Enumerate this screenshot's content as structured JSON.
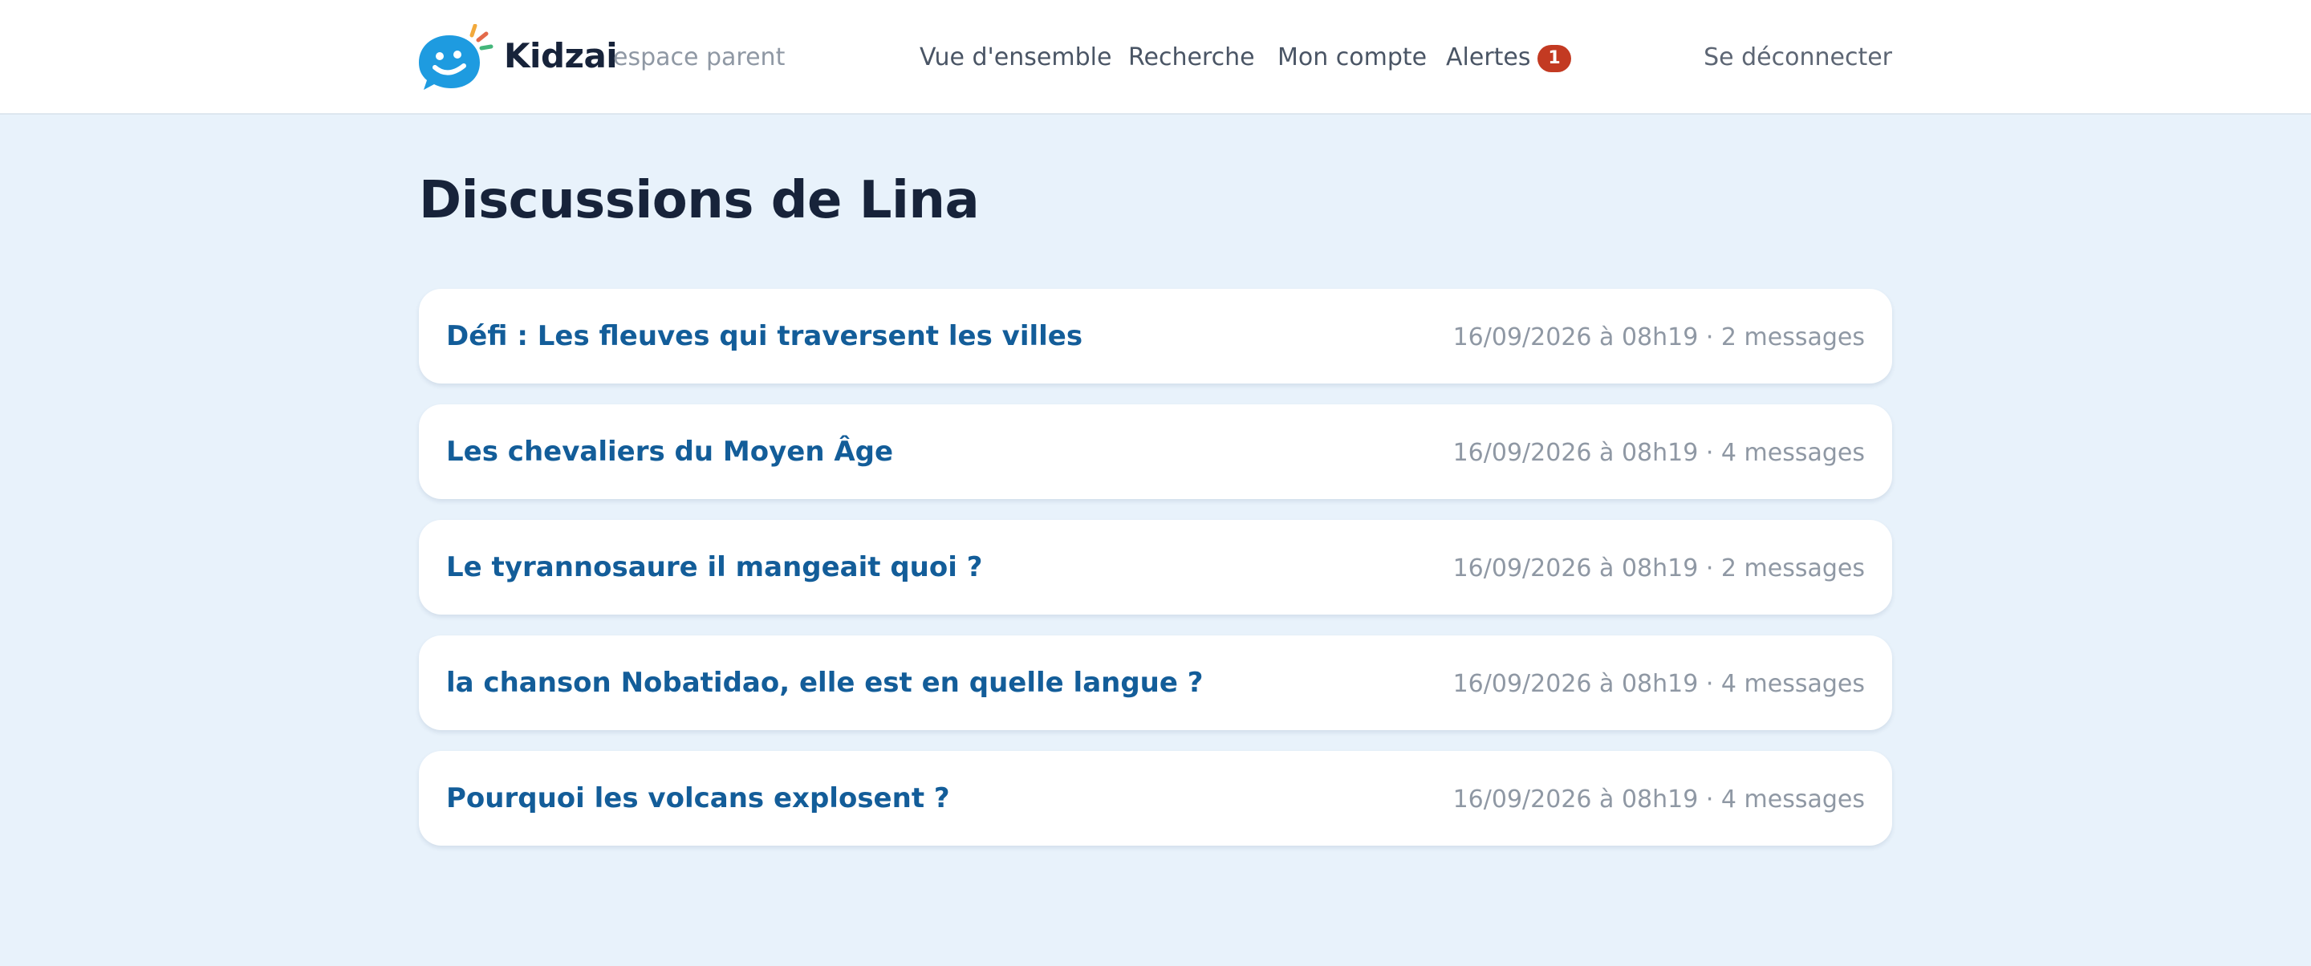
{
  "header": {
    "brand": "Kidzai",
    "brand_sub": "espace parent",
    "nav": {
      "overview": "Vue d'ensemble",
      "search": "Recherche",
      "account": "Mon compte",
      "alerts": "Alertes",
      "alerts_count": "1"
    },
    "logout": "Se déconnecter"
  },
  "colors": {
    "background": "#e8f2fb",
    "title": "#17233a",
    "link": "#135d99",
    "badge": "#c33a22",
    "logo_blue": "#1e9be0"
  },
  "page": {
    "title": "Discussions de Lina"
  },
  "discussions": [
    {
      "title": "Défi : Les fleuves qui traversent les villes",
      "meta": "16/09/2026 à 08h19 · 2 messages"
    },
    {
      "title": "Les chevaliers du Moyen Âge",
      "meta": "16/09/2026 à 08h19 · 4 messages"
    },
    {
      "title": "Le tyrannosaure il mangeait quoi ?",
      "meta": "16/09/2026 à 08h19 · 2 messages"
    },
    {
      "title": "la chanson Nobatidao, elle est en quelle langue ?",
      "meta": "16/09/2026 à 08h19 · 4 messages"
    },
    {
      "title": "Pourquoi les volcans explosent ?",
      "meta": "16/09/2026 à 08h19 · 4 messages"
    }
  ]
}
